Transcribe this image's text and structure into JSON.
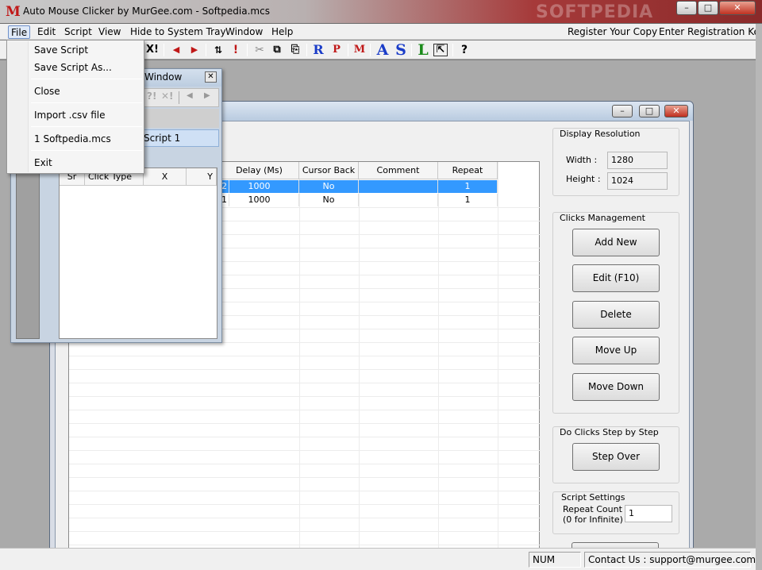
{
  "app": {
    "title": "Auto Mouse Clicker by MurGee.com - Softpedia.mcs",
    "icon_letter": "M",
    "watermark": "SOFTPEDIA"
  },
  "menu": {
    "items": [
      "File",
      "Edit",
      "Script",
      "View",
      "Hide to System Tray",
      "Window",
      "Help"
    ],
    "right_items": [
      "Register Your Copy",
      "Enter Registration Key"
    ],
    "active": "File"
  },
  "file_menu": {
    "save_script": "Save Script",
    "save_script_as": "Save Script As...",
    "close": "Close",
    "import_csv": "Import .csv file",
    "recent_1": "1 Softpedia.mcs",
    "exit": "Exit"
  },
  "toolbar": {
    "delete_icon": "X!",
    "red_r": "R",
    "red_p": "P",
    "red_m": "M",
    "blue_a": "A",
    "blue_s": "S",
    "green_l": "L",
    "help_icon": "?"
  },
  "script_explorer": {
    "title": "Window",
    "tab_label": "Script 1",
    "columns": [
      "Sr",
      "Click Type",
      "X",
      "Y"
    ]
  },
  "grid": {
    "columns": [
      "Delay (Ms)",
      "Cursor Back",
      "Comment",
      "Repeat"
    ],
    "rows": [
      {
        "prefix": "2",
        "delay": "1000",
        "cursor_back": "No",
        "comment": "",
        "repeat": "1"
      },
      {
        "prefix": "1",
        "delay": "1000",
        "cursor_back": "No",
        "comment": "",
        "repeat": "1"
      }
    ]
  },
  "display_resolution": {
    "label": "Display Resolution",
    "width_label": "Width :",
    "width": "1280",
    "height_label": "Height :",
    "height": "1024"
  },
  "clicks_management": {
    "label": "Clicks Management",
    "add_new": "Add New",
    "edit": "Edit (F10)",
    "delete": "Delete",
    "move_up": "Move Up",
    "move_down": "Move Down"
  },
  "step": {
    "label": "Do Clicks Step by Step",
    "step_over": "Step Over"
  },
  "script_settings": {
    "label": "Script Settings",
    "repeat_label_1": "Repeat Count",
    "repeat_label_2": "(0 for Infinite) :",
    "repeat_value": "1"
  },
  "status": {
    "num": "NUM",
    "contact": "Contact Us : support@murgee.com"
  },
  "colors": {
    "selection": "#3399ff",
    "red": "#c01818",
    "blue": "#1a3cc8",
    "green": "#1a8a1a"
  }
}
